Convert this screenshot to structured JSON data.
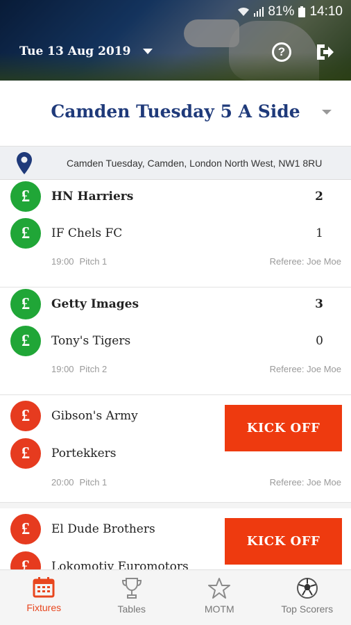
{
  "status_bar": {
    "battery": "81%",
    "time": "14:10"
  },
  "header": {
    "date": "Tue 13 Aug 2019"
  },
  "league": {
    "title": "Camden Tuesday 5 A Side"
  },
  "venue": {
    "address": "Camden Tuesday, Camden, London North West, NW1 8RU"
  },
  "matches": [
    {
      "home": {
        "name": "HN Harriers",
        "score": "2"
      },
      "away": {
        "name": "IF Chels FC",
        "score": "1"
      },
      "time": "19:00",
      "pitch": "Pitch 1",
      "referee": "Referee: Joe Moe"
    },
    {
      "home": {
        "name": "Getty Images",
        "score": "3"
      },
      "away": {
        "name": "Tony's Tigers",
        "score": "0"
      },
      "time": "19:00",
      "pitch": "Pitch 2",
      "referee": "Referee: Joe Moe"
    },
    {
      "home": {
        "name": "Gibson's Army"
      },
      "away": {
        "name": "Portekkers"
      },
      "time": "20:00",
      "pitch": "Pitch 1",
      "referee": "Referee: Joe Moe",
      "action": "KICK OFF"
    },
    {
      "home": {
        "name": "El Dude Brothers"
      },
      "away": {
        "name": "Lokomotiv Euromotors"
      },
      "action": "KICK OFF"
    }
  ],
  "team_icon": "£",
  "tabs": [
    {
      "label": "Fixtures",
      "icon": "calendar-icon",
      "active": true
    },
    {
      "label": "Tables",
      "icon": "trophy-icon"
    },
    {
      "label": "MOTM",
      "icon": "star-icon"
    },
    {
      "label": "Top Scorers",
      "icon": "football-icon"
    }
  ],
  "colors": {
    "accent": "#e8461e",
    "win": "#20a637",
    "pending": "#e63b1f",
    "league_title": "#1f3a7a"
  }
}
